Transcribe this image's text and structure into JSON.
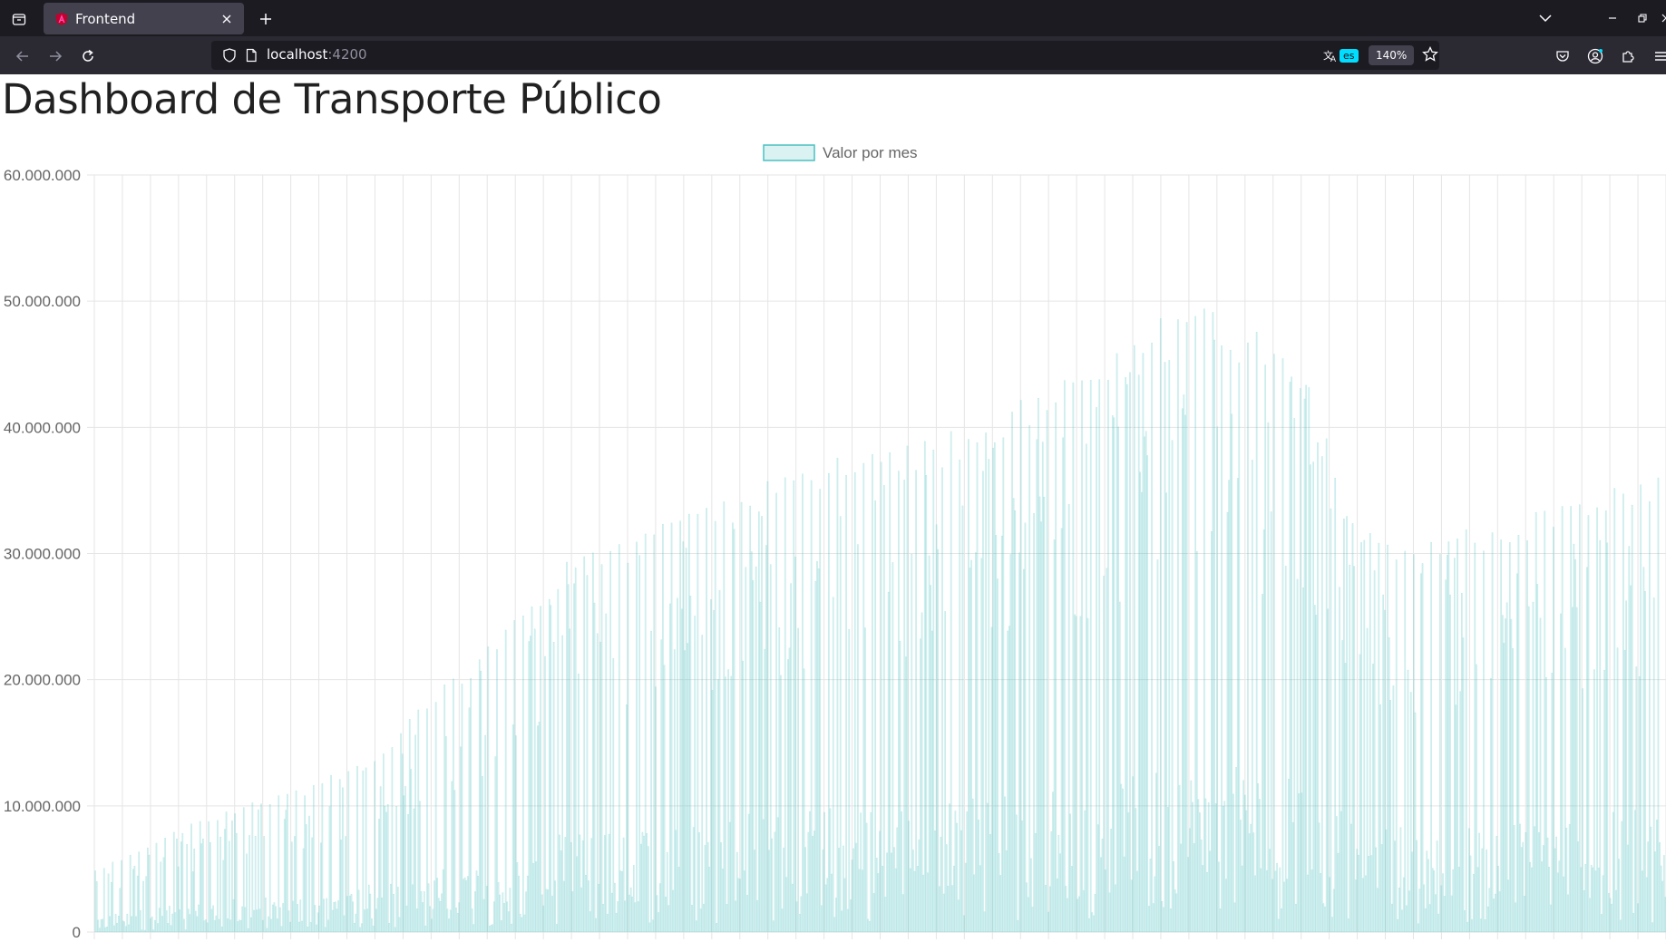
{
  "browser": {
    "tab_title": "Frontend",
    "url_host": "localhost",
    "url_port": ":4200",
    "translate_lang": "es",
    "zoom_level": "140%",
    "accent_color": "#00ddff"
  },
  "page": {
    "title": "Dashboard de Transporte Público"
  },
  "chart_data": {
    "type": "bar",
    "legend": "Valor por mes",
    "legend_position": "top-center",
    "grid": true,
    "bar_color": "#4bc0c0",
    "bar_fill": "rgba(75,192,192,0.2)",
    "ylim": [
      0,
      60000000
    ],
    "y_ticks": [
      "0",
      "10.000.000",
      "20.000.000",
      "30.000.000",
      "40.000.000",
      "50.000.000",
      "60.000.000"
    ],
    "envelope_points": [
      [
        0,
        5000000
      ],
      [
        6,
        7000000
      ],
      [
        12,
        9000000
      ],
      [
        18,
        10500000
      ],
      [
        24,
        11500000
      ],
      [
        30,
        13500000
      ],
      [
        36,
        17000000
      ],
      [
        42,
        21000000
      ],
      [
        48,
        25000000
      ],
      [
        54,
        29500000
      ],
      [
        60,
        31000000
      ],
      [
        66,
        33500000
      ],
      [
        72,
        35000000
      ],
      [
        78,
        36000000
      ],
      [
        84,
        37500000
      ],
      [
        90,
        38500000
      ],
      [
        96,
        39500000
      ],
      [
        102,
        41000000
      ],
      [
        108,
        43000000
      ],
      [
        114,
        45000000
      ],
      [
        120,
        48000000
      ],
      [
        126,
        50000000
      ],
      [
        132,
        48500000
      ],
      [
        138,
        46000000
      ],
      [
        144,
        33000000
      ],
      [
        150,
        31500000
      ],
      [
        156,
        32000000
      ],
      [
        162,
        33500000
      ],
      [
        168,
        34000000
      ],
      [
        174,
        35500000
      ],
      [
        179,
        37000000
      ]
    ],
    "bar_count": 180
  }
}
